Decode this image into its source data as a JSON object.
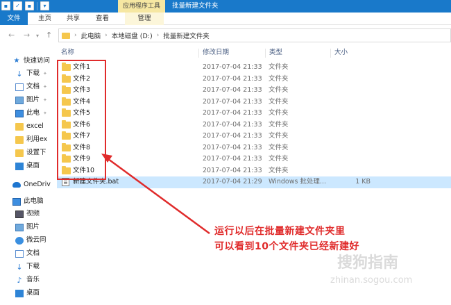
{
  "titlebar": {
    "context_tab": "应用程序工具",
    "window_title": "批量新建文件夹"
  },
  "ribbon": {
    "tabs": [
      "文件",
      "主页",
      "共享",
      "查看",
      "管理"
    ]
  },
  "address": {
    "crumbs": [
      "此电脑",
      "本地磁盘 (D:)",
      "批量新建文件夹"
    ]
  },
  "nav_pane": {
    "items": [
      "快速访问",
      "下载",
      "文档",
      "图片",
      "此电",
      "excel",
      "利用ex",
      "设置下",
      "桌面",
      "OneDriv",
      "此电脑",
      "视频",
      "图片",
      "微云同",
      "文档",
      "下载",
      "音乐",
      "桌面"
    ]
  },
  "columns": {
    "name": "名称",
    "date": "修改日期",
    "type": "类型",
    "size": "大小"
  },
  "files": [
    {
      "name": "文件1",
      "date": "2017-07-04 21:33",
      "type": "文件夹",
      "size": ""
    },
    {
      "name": "文件2",
      "date": "2017-07-04 21:33",
      "type": "文件夹",
      "size": ""
    },
    {
      "name": "文件3",
      "date": "2017-07-04 21:33",
      "type": "文件夹",
      "size": ""
    },
    {
      "name": "文件4",
      "date": "2017-07-04 21:33",
      "type": "文件夹",
      "size": ""
    },
    {
      "name": "文件5",
      "date": "2017-07-04 21:33",
      "type": "文件夹",
      "size": ""
    },
    {
      "name": "文件6",
      "date": "2017-07-04 21:33",
      "type": "文件夹",
      "size": ""
    },
    {
      "name": "文件7",
      "date": "2017-07-04 21:33",
      "type": "文件夹",
      "size": ""
    },
    {
      "name": "文件8",
      "date": "2017-07-04 21:33",
      "type": "文件夹",
      "size": ""
    },
    {
      "name": "文件9",
      "date": "2017-07-04 21:33",
      "type": "文件夹",
      "size": ""
    },
    {
      "name": "文件10",
      "date": "2017-07-04 21:33",
      "type": "文件夹",
      "size": ""
    },
    {
      "name": "新建文件夹.bat",
      "date": "2017-07-04 21:29",
      "type": "Windows 批处理...",
      "size": "1 KB"
    }
  ],
  "annotation": {
    "line1": "运行以后在批量新建文件夹里",
    "line2": "可以看到10个文件夹已经新建好",
    "color": "#e02b2b"
  },
  "watermark": {
    "text": "搜狗指南",
    "sub": "zhinan.sogou.com"
  },
  "colors": {
    "accent": "#1979ca",
    "selected_row": "#cce8ff",
    "folder": "#f5c74d"
  }
}
